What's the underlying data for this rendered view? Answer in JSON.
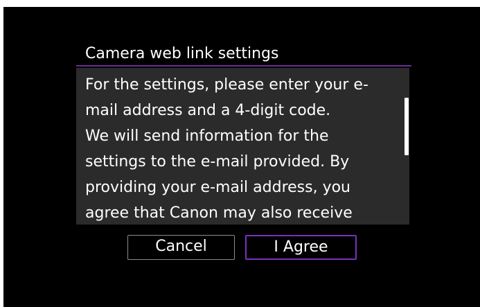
{
  "dialog": {
    "title": "Camera web link settings",
    "message_lines": [
      "For the settings, please enter your e-",
      "mail address and a 4-digit code.",
      "We will send information for the",
      "settings to the e-mail provided. By",
      "providing your e-mail address, you",
      "agree that Canon may also receive"
    ]
  },
  "buttons": {
    "cancel_label": "Cancel",
    "agree_label": "I Agree"
  },
  "colors": {
    "background": "#000000",
    "panel": "#2b2b2b",
    "accent": "#7b2fc0",
    "text": "#ffffff"
  },
  "scrollbar": {
    "position_fraction": 0.19,
    "visible_fraction": 0.37
  }
}
